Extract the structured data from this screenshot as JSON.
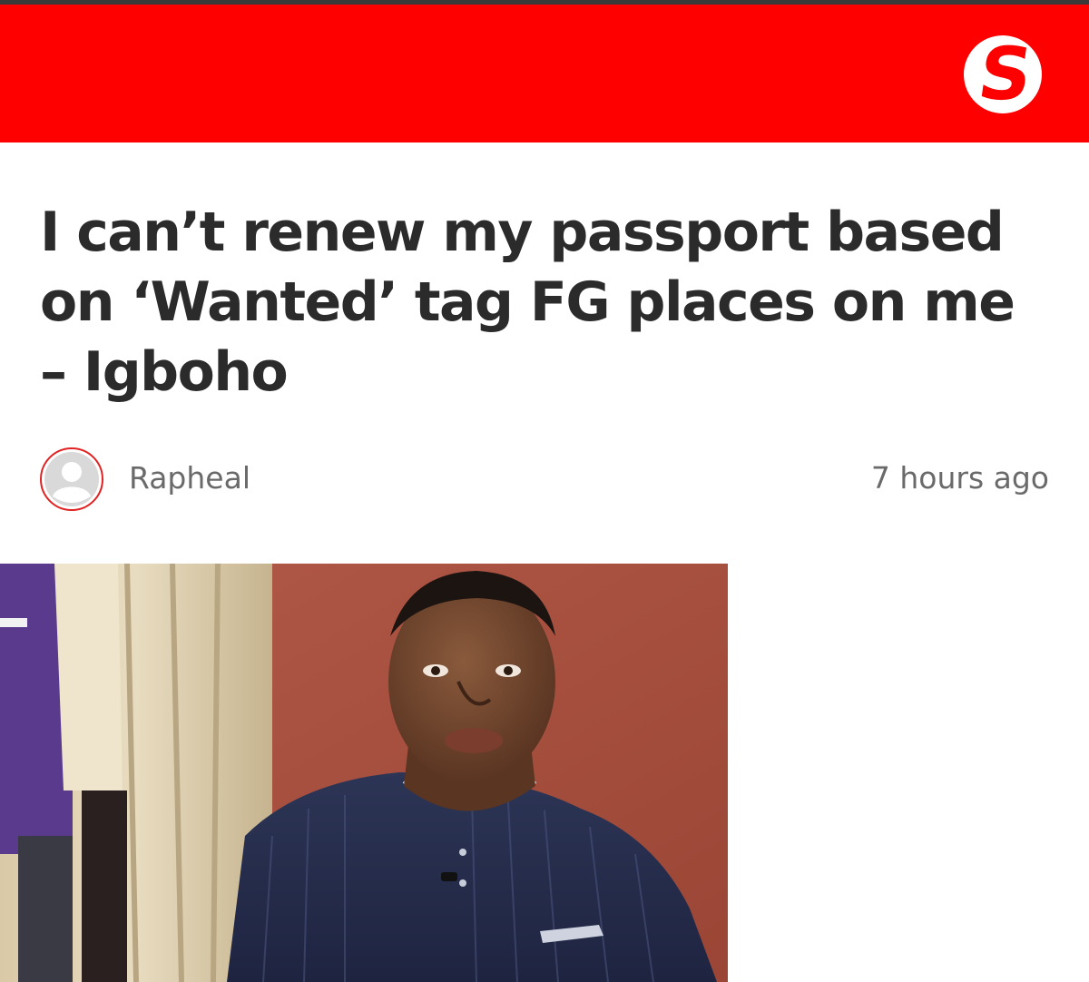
{
  "site": {
    "logo_letter": "S",
    "brand_color": "#fe0000"
  },
  "article": {
    "headline": "I can’t renew my passport based on ‘Wanted’ tag FG places on me – Igboho",
    "author": "Rapheal",
    "time_ago": "7 hours ago",
    "author_avatar_icon": "user-avatar-placeholder-icon",
    "hero_image_icon": "article-photo"
  }
}
